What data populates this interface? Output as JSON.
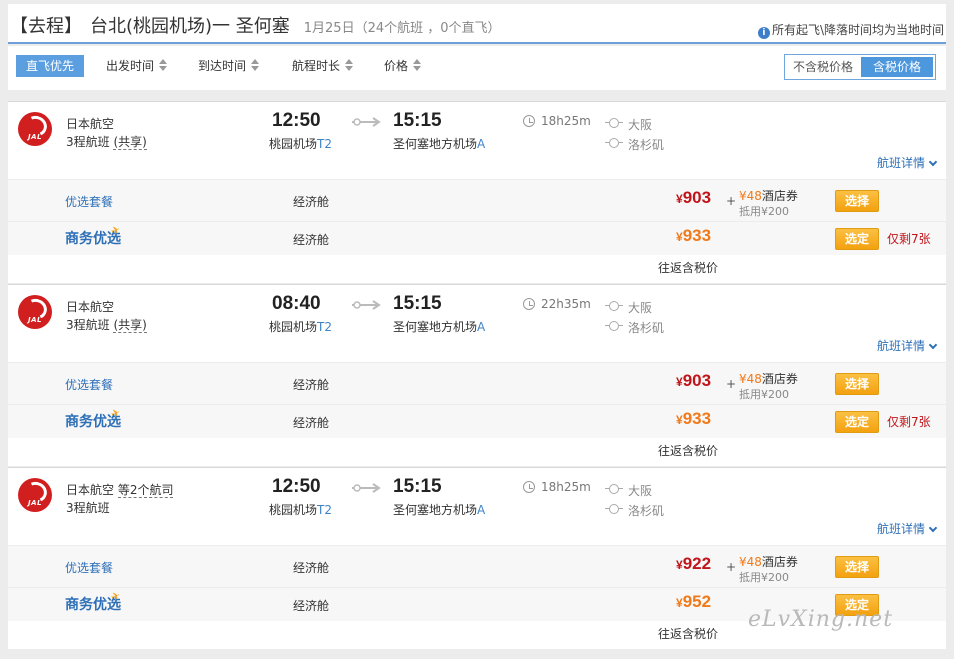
{
  "header": {
    "trip_type": "【去程】",
    "route": "台北(桃园机场)一 圣何塞",
    "meta": "1月25日（24个航班 ，0个直飞）",
    "timezone_note": "所有起飞\\降落时间均为当地时间"
  },
  "sortbar": {
    "items": [
      "直飞优先",
      "出发时间",
      "到达时间",
      "航程时长",
      "价格"
    ],
    "tax_exclusive": "不含税价格",
    "tax_inclusive": "含税价格"
  },
  "flights": [
    {
      "airline": "日本航空",
      "airline_more": "",
      "segments": "3程航班",
      "share": "(共享)",
      "dep_time": "12:50",
      "arr_time": "15:15",
      "dep_airport": "桃园机场",
      "dep_terminal": "T2",
      "arr_airport": "圣何塞地方机场",
      "arr_terminal": "A",
      "duration": "18h25m",
      "stops": [
        "大阪",
        "洛杉矶"
      ],
      "details": "航班详情",
      "packages": [
        {
          "name": "优选套餐",
          "cabin": "经济舱",
          "yen": "¥",
          "price": "903",
          "plus": "+",
          "voucher_amt": "¥48",
          "voucher": "酒店券",
          "offset": "抵用¥200",
          "button": "选择",
          "remain": ""
        },
        {
          "name": "商务优选",
          "cabin": "经济舱",
          "yen": "¥",
          "price": "933",
          "button": "选定",
          "remain": "仅剩7张"
        }
      ],
      "roundtrip": "往返含税价"
    },
    {
      "airline": "日本航空",
      "airline_more": "",
      "segments": "3程航班",
      "share": "(共享)",
      "dep_time": "08:40",
      "arr_time": "15:15",
      "dep_airport": "桃园机场",
      "dep_terminal": "T2",
      "arr_airport": "圣何塞地方机场",
      "arr_terminal": "A",
      "duration": "22h35m",
      "stops": [
        "大阪",
        "洛杉矶"
      ],
      "details": "航班详情",
      "packages": [
        {
          "name": "优选套餐",
          "cabin": "经济舱",
          "yen": "¥",
          "price": "903",
          "plus": "+",
          "voucher_amt": "¥48",
          "voucher": "酒店券",
          "offset": "抵用¥200",
          "button": "选择",
          "remain": ""
        },
        {
          "name": "商务优选",
          "cabin": "经济舱",
          "yen": "¥",
          "price": "933",
          "button": "选定",
          "remain": "仅剩7张"
        }
      ],
      "roundtrip": "往返含税价"
    },
    {
      "airline": "日本航空",
      "airline_more": "等2个航司",
      "segments": "3程航班",
      "share": "",
      "dep_time": "12:50",
      "arr_time": "15:15",
      "dep_airport": "桃园机场",
      "dep_terminal": "T2",
      "arr_airport": "圣何塞地方机场",
      "arr_terminal": "A",
      "duration": "18h25m",
      "stops": [
        "大阪",
        "洛杉矶"
      ],
      "details": "航班详情",
      "packages": [
        {
          "name": "优选套餐",
          "cabin": "经济舱",
          "yen": "¥",
          "price": "922",
          "plus": "+",
          "voucher_amt": "¥48",
          "voucher": "酒店券",
          "offset": "抵用¥200",
          "button": "选择",
          "remain": ""
        },
        {
          "name": "商务优选",
          "cabin": "经济舱",
          "yen": "¥",
          "price": "952",
          "button": "选定",
          "remain": ""
        }
      ],
      "roundtrip": "往返含税价"
    }
  ],
  "logo_text": "JAL",
  "watermark": "eLvXing.net",
  "colors": {
    "accent": "#4d97dd",
    "price_red": "#c0151b",
    "price_orange": "#f07a1a",
    "button": "#f3a10f",
    "link": "#2d6fb7"
  }
}
